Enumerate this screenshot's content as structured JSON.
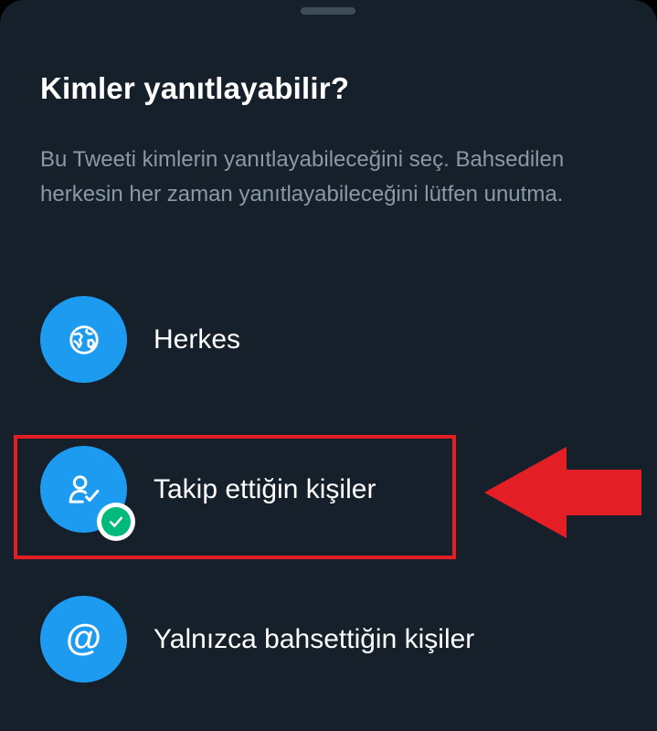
{
  "sheet": {
    "title": "Kimler yanıtlayabilir?",
    "description": "Bu Tweeti kimlerin yanıtlayabileceğini seç. Bahsedilen herkesin her zaman yanıtlayabileceğini lütfen unutma."
  },
  "options": [
    {
      "label": "Herkes",
      "icon": "globe-icon",
      "selected": false
    },
    {
      "label": "Takip ettiğin kişiler",
      "icon": "person-check-icon",
      "selected": true
    },
    {
      "label": "Yalnızca bahsettiğin kişiler",
      "icon": "at-sign-icon",
      "selected": false
    }
  ],
  "colors": {
    "background": "#15202b",
    "accent": "#1d9bf0",
    "selected_check": "#00ba7c",
    "annotation_red": "#e31e25"
  }
}
